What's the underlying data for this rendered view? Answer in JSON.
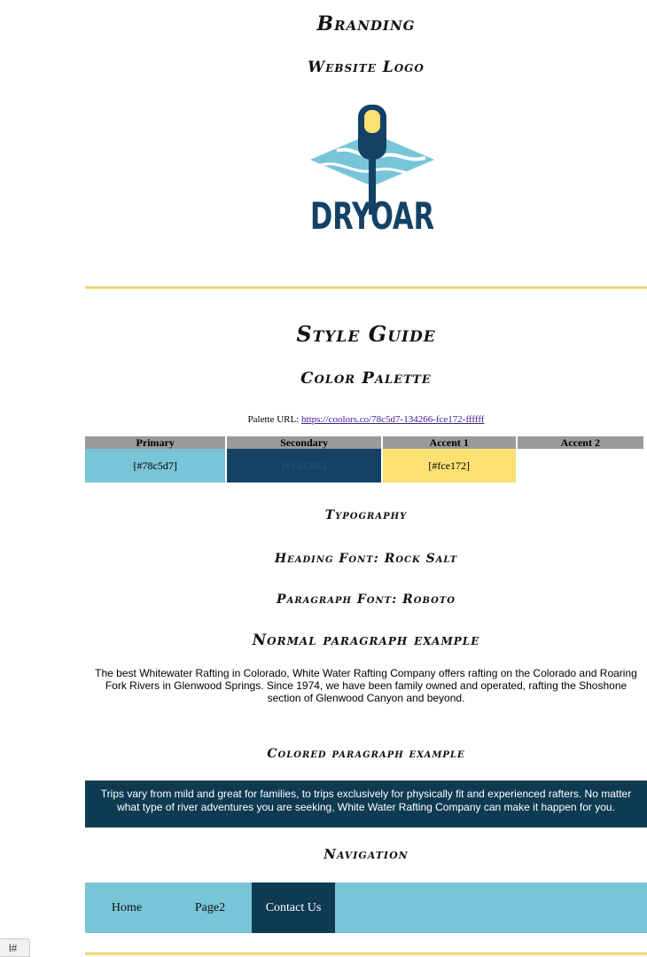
{
  "branding": {
    "heading": "Branding",
    "logo_heading": "Website Logo",
    "logo_text": "DRYOAR"
  },
  "style_guide": {
    "heading": "Style Guide",
    "palette_heading": "Color Palette",
    "palette_url_label": "Palette URL:",
    "palette_url": "https://coolors.co/78c5d7-134266-fce172-ffffff",
    "palette": {
      "headers": [
        "Primary",
        "Secondary",
        "Accent 1",
        "Accent 2"
      ],
      "values": [
        "[#78c5d7]",
        "[#134266]",
        "[#fce172]",
        ""
      ]
    },
    "colors": {
      "primary": "#78c5d7",
      "secondary": "#134266",
      "accent1": "#fce172",
      "accent2": "#ffffff"
    }
  },
  "typography": {
    "heading": "Typography",
    "heading_font": "Heading Font: Rock Salt",
    "paragraph_font": "Paragraph Font: Roboto",
    "normal_heading": "Normal paragraph example",
    "normal_text": "The best Whitewater Rafting in Colorado, White Water Rafting Company offers rafting on the Colorado and Roaring Fork Rivers in Glenwood Springs. Since 1974, we have been family owned and operated, rafting the Shoshone section of Glenwood Canyon and beyond.",
    "colored_heading": "Colored paragraph example",
    "colored_text": "Trips vary from mild and great for families, to trips exclusively for physically fit and experienced rafters. No matter what type of river adventures you are seeking, White Water Rafting Company can make it happen for you."
  },
  "navigation": {
    "heading": "Navigation",
    "items": [
      "Home",
      "Page2",
      "Contact Us"
    ]
  },
  "corner_tag": "l#"
}
